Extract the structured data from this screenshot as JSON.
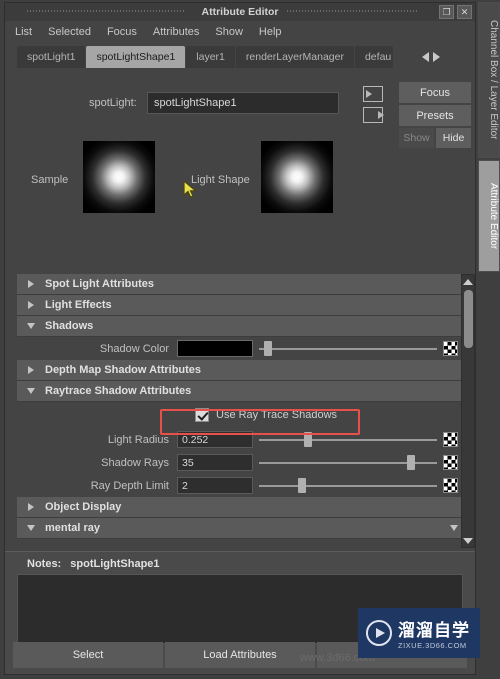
{
  "window": {
    "title": "Attribute Editor",
    "restore_icon": "restore-icon",
    "restore_glyph": "❐",
    "close_glyph": "✕"
  },
  "menubar": {
    "items": [
      "List",
      "Selected",
      "Focus",
      "Attributes",
      "Show",
      "Help"
    ]
  },
  "tabs": {
    "items": [
      {
        "label": "spotLight1",
        "active": false
      },
      {
        "label": "spotLightShape1",
        "active": true
      },
      {
        "label": "layer1",
        "active": false
      },
      {
        "label": "renderLayerManager",
        "active": false
      },
      {
        "label": "defau",
        "active": false
      }
    ],
    "prev_arrow": "tab-prev-arrow",
    "next_arrow": "tab-next-arrow"
  },
  "node": {
    "type_label": "spotLight:",
    "name_value": "spotLightShape1",
    "name_placeholder": "node name"
  },
  "buttons": {
    "focus": "Focus",
    "presets": "Presets",
    "show": "Show",
    "hide": "Hide"
  },
  "previews": {
    "sample_label": "Sample",
    "light_shape_label": "Light Shape"
  },
  "attributes": {
    "sections": [
      {
        "title": "Spot Light Attributes",
        "expanded": false
      },
      {
        "title": "Light Effects",
        "expanded": false
      },
      {
        "title": "Shadows",
        "expanded": true
      },
      {
        "title": "Depth Map Shadow Attributes",
        "expanded": false
      },
      {
        "title": "Raytrace Shadow Attributes",
        "expanded": true
      },
      {
        "title": "Object Display",
        "expanded": false
      },
      {
        "title": "mental ray",
        "expanded": true
      }
    ],
    "shadow_color": {
      "label": "Shadow Color",
      "value": "#000000",
      "slider_pct": 3
    },
    "use_ray_trace_shadows": {
      "label": "Use Ray Trace Shadows",
      "checked": true
    },
    "light_radius": {
      "label": "Light Radius",
      "value": "0.252",
      "slider_pct": 25
    },
    "shadow_rays": {
      "label": "Shadow Rays",
      "value": "35",
      "slider_pct": 83
    },
    "ray_depth_limit": {
      "label": "Ray Depth Limit",
      "value": "2",
      "slider_pct": 22
    }
  },
  "notes": {
    "label": "Notes:",
    "target": "spotLightShape1",
    "text": ""
  },
  "footer": {
    "select": "Select",
    "load_attributes": "Load Attributes",
    "third": ""
  },
  "sidebar": {
    "tabs": [
      "Channel Box / Layer Editor",
      "Attribute Editor"
    ]
  },
  "watermark": {
    "cn": "溜溜自学",
    "en": "ZIXUE.3D66.COM",
    "ghost": "www.3d66.com"
  },
  "colors": {
    "highlight_box": "#e8504a",
    "active_tab_bg": "#a6a6a6",
    "panel_bg": "#444444",
    "section_bg": "#5a5a5a",
    "watermark_bg": "#1e3763"
  }
}
